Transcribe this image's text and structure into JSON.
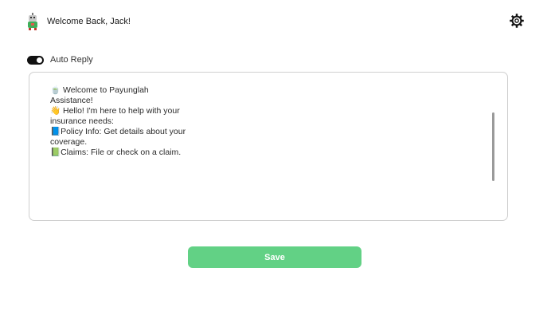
{
  "header": {
    "welcome_text": "Welcome Back, Jack!",
    "avatar_icon": "robot-avatar-icon",
    "settings_icon": "gear-icon"
  },
  "auto_reply": {
    "label": "Auto Reply",
    "enabled": true
  },
  "message": {
    "text": "🍵 Welcome to Payunglah\nAssistance!\n👋 Hello! I'm here to help with your\ninsurance needs:\n📘Policy Info: Get details about your\ncoverage.\n📗Claims: File or check on a claim."
  },
  "save_button": {
    "label": "Save"
  },
  "colors": {
    "accent": "#62d185",
    "toggle_on": "#111111",
    "border": "#cfcfcf"
  }
}
